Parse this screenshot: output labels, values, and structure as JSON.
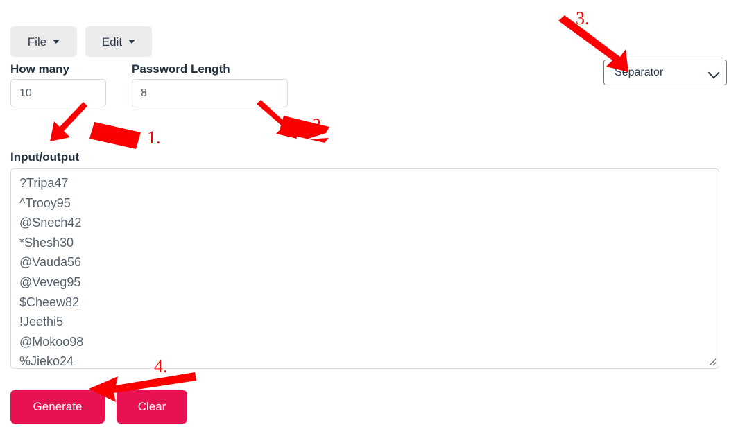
{
  "menubar": {
    "items": [
      {
        "label": "File",
        "icon": "caret-down-icon"
      },
      {
        "label": "Edit",
        "icon": "caret-down-icon"
      }
    ]
  },
  "form": {
    "how_many": {
      "label": "How many",
      "value": "10",
      "placeholder": "How many"
    },
    "password_length": {
      "label": "Password Length",
      "value": "8",
      "placeholder": "Password Length"
    },
    "separator": {
      "selected": "Separator",
      "options": [
        "Separator"
      ],
      "icon": "chevron-down-icon"
    }
  },
  "io": {
    "label": "Input/output",
    "placeholder": "",
    "lines": [
      "?Tripa47",
      "^Trooy95",
      "@Snech42",
      "*Shesh30",
      "@Vauda56",
      "@Veveg95",
      "$Cheew82",
      "!Jeethi5",
      "@Mokoo98",
      "%Jieko24"
    ],
    "value": "?Tripa47\n^Trooy95\n@Snech42\n*Shesh30\n@Vauda56\n@Veveg95\n$Cheew82\n!Jeethi5\n@Mokoo98\n%Jieko24",
    "resize_handle": "resize-grip-icon"
  },
  "actions": {
    "generate_label": "Generate",
    "clear_label": "Clear"
  },
  "annotations": {
    "color": "#fa0000",
    "markers": [
      {
        "number": "1.",
        "target": "how-many-input"
      },
      {
        "number": "2.",
        "target": "password-length-input"
      },
      {
        "number": "3.",
        "target": "separator-select"
      },
      {
        "number": "4.",
        "target": "generate-button"
      }
    ]
  },
  "colors": {
    "accent": "#e81252",
    "menu_button_bg": "#ececec",
    "text_dark": "#22313f",
    "input_text": "#55606b",
    "border": "#d8dadd",
    "annotation_red": "#fa0000",
    "page_bg": "#ffffff"
  }
}
